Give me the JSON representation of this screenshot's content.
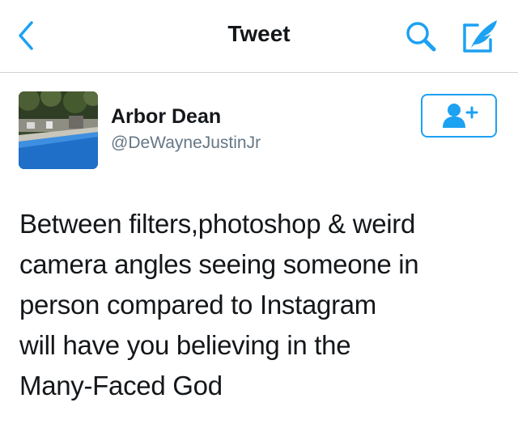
{
  "nav": {
    "title": "Tweet",
    "back_icon": "chevron-left-icon",
    "search_icon": "search-icon",
    "compose_icon": "compose-tweet-icon",
    "accent_color": "#1da1f2"
  },
  "tweet": {
    "author": {
      "name": "Arbor Dean",
      "handle": "@DeWayneJustinJr",
      "avatar": "pool-photo-avatar"
    },
    "follow_icon": "add-user-icon",
    "text_lines": [
      "Between filters,photoshop & weird",
      "camera angles seeing someone in",
      "person compared to Instagram",
      "will have you believing in the",
      "Many-Faced God"
    ]
  }
}
